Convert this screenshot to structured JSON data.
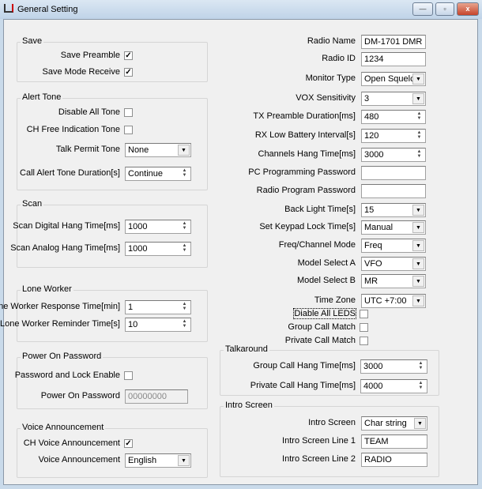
{
  "window": {
    "title": "General Setting",
    "minimize": "—",
    "maximize": "▫",
    "close": "x",
    "app_icon": "book-icon"
  },
  "save": {
    "title": "Save",
    "items": [
      {
        "label": "Save Preamble",
        "type": "check",
        "checked": true
      },
      {
        "label": "Save Mode Receive",
        "type": "check",
        "checked": true
      }
    ]
  },
  "alert_tone": {
    "title": "Alert Tone",
    "items": [
      {
        "label": "Disable All Tone",
        "type": "check",
        "checked": false
      },
      {
        "label": "CH Free Indication Tone",
        "type": "check",
        "checked": false
      },
      {
        "label": "Talk Permit Tone",
        "type": "combo",
        "value": "None"
      },
      {
        "label": "Call Alert Tone Duration[s]",
        "type": "spin",
        "value": "Continue"
      }
    ]
  },
  "scan": {
    "title": "Scan",
    "items": [
      {
        "label": "Scan Digital Hang Time[ms]",
        "type": "spin",
        "value": "1000"
      },
      {
        "label": "Scan Analog Hang Time[ms]",
        "type": "spin",
        "value": "1000"
      }
    ]
  },
  "lone_worker": {
    "title": "Lone Worker",
    "items": [
      {
        "label": "Lone Worker Response Time[min]",
        "type": "spin",
        "value": "1"
      },
      {
        "label": "Lone Worker Reminder Time[s]",
        "type": "spin",
        "value": "10"
      }
    ]
  },
  "power_on_password": {
    "title": "Power On Password",
    "items": [
      {
        "label": "Password and Lock Enable",
        "type": "check",
        "checked": false
      },
      {
        "label": "Power On Password",
        "type": "text",
        "value": "00000000",
        "disabled": true
      }
    ]
  },
  "voice_announcement": {
    "title": "Voice Announcement",
    "items": [
      {
        "label": "CH Voice Announcement",
        "type": "check",
        "checked": true
      },
      {
        "label": "Voice Announcement",
        "type": "combo",
        "value": "English"
      }
    ]
  },
  "general": {
    "items": [
      {
        "label": "Radio Name",
        "type": "text",
        "value": "DM-1701 DMR"
      },
      {
        "label": "Radio ID",
        "type": "text",
        "value": "1234"
      },
      {
        "label": "Monitor Type",
        "type": "combo",
        "value": "Open Squelch"
      },
      {
        "label": "VOX Sensitivity",
        "type": "combo",
        "value": "3"
      },
      {
        "label": "TX Preamble Duration[ms]",
        "type": "spin",
        "value": "480"
      },
      {
        "label": "RX Low Battery Interval[s]",
        "type": "spin",
        "value": "120"
      },
      {
        "label": "Channels Hang Time[ms]",
        "type": "spin",
        "value": "3000"
      },
      {
        "label": "PC Programming Password",
        "type": "text",
        "value": ""
      },
      {
        "label": "Radio Program Password",
        "type": "text",
        "value": ""
      },
      {
        "label": "Back Light Time[s]",
        "type": "combo",
        "value": "15"
      },
      {
        "label": "Set Keypad Lock Time[s]",
        "type": "combo",
        "value": "Manual"
      },
      {
        "label": "Freq/Channel Mode",
        "type": "combo",
        "value": "Freq"
      },
      {
        "label": "Model Select A",
        "type": "combo",
        "value": "VFO"
      },
      {
        "label": "Model Select B",
        "type": "combo",
        "value": "MR"
      },
      {
        "label": "Time Zone",
        "type": "combo",
        "value": "UTC +7:00"
      },
      {
        "label": "Diable All LEDS",
        "type": "check",
        "checked": false,
        "focused": true
      },
      {
        "label": "Group Call Match",
        "type": "check",
        "checked": false
      },
      {
        "label": "Private Call Match",
        "type": "check",
        "checked": false
      }
    ]
  },
  "talkaround": {
    "title": "Talkaround",
    "items": [
      {
        "label": "Group Call Hang Time[ms]",
        "type": "spin",
        "value": "3000"
      },
      {
        "label": "Private Call Hang Time[ms]",
        "type": "spin",
        "value": "4000"
      }
    ]
  },
  "intro_screen": {
    "title": "Intro Screen",
    "items": [
      {
        "label": "Intro Screen",
        "type": "combo",
        "value": "Char string"
      },
      {
        "label": "Intro Screen Line 1",
        "type": "text",
        "value": "TEAM"
      },
      {
        "label": "Intro Screen Line 2",
        "type": "text",
        "value": "RADIO"
      }
    ]
  }
}
